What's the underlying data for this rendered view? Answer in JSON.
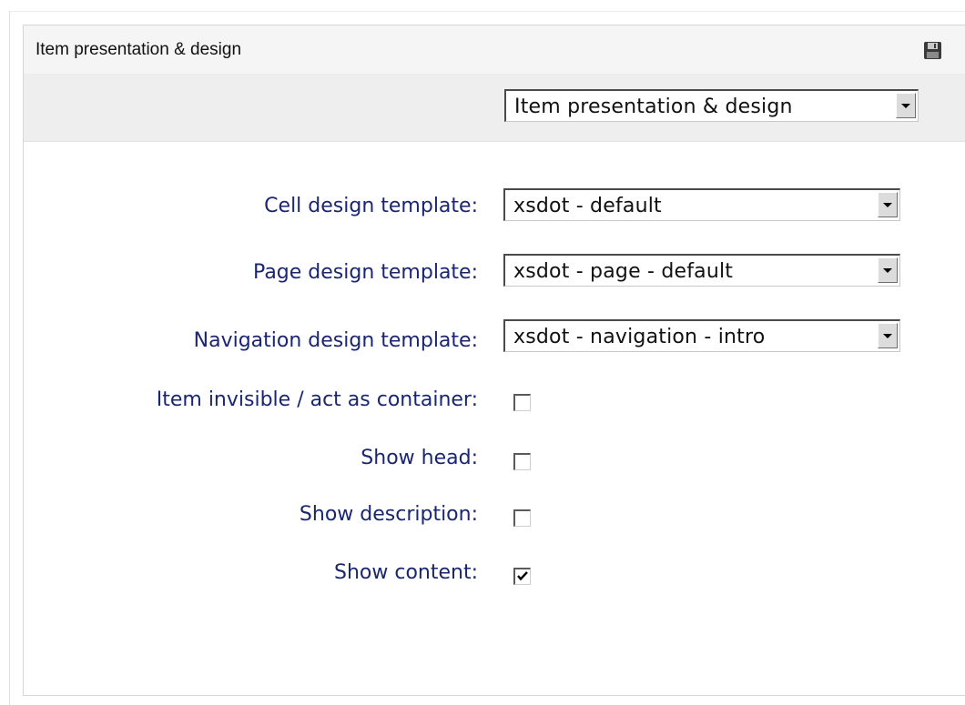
{
  "panel": {
    "title": "Item presentation & design",
    "save_icon": "floppy-disk-icon",
    "section_select": {
      "value": "Item presentation & design"
    }
  },
  "form": {
    "fields": [
      {
        "label": "Cell design template:",
        "type": "select",
        "value": "xsdot - default"
      },
      {
        "label": "Page design template:",
        "type": "select",
        "value": "xsdot - page - default"
      },
      {
        "label": "Navigation design template:",
        "type": "select",
        "value": "xsdot - navigation - intro"
      },
      {
        "label": "Item invisible / act as container:",
        "type": "checkbox",
        "checked": false
      },
      {
        "label": "Show head:",
        "type": "checkbox",
        "checked": false
      },
      {
        "label": "Show description:",
        "type": "checkbox",
        "checked": false
      },
      {
        "label": "Show content:",
        "type": "checkbox",
        "checked": true
      }
    ]
  },
  "colors": {
    "label_text": "#1a2670",
    "header_bg": "#f5f5f5",
    "toolbar_bg": "#eeeeef"
  }
}
